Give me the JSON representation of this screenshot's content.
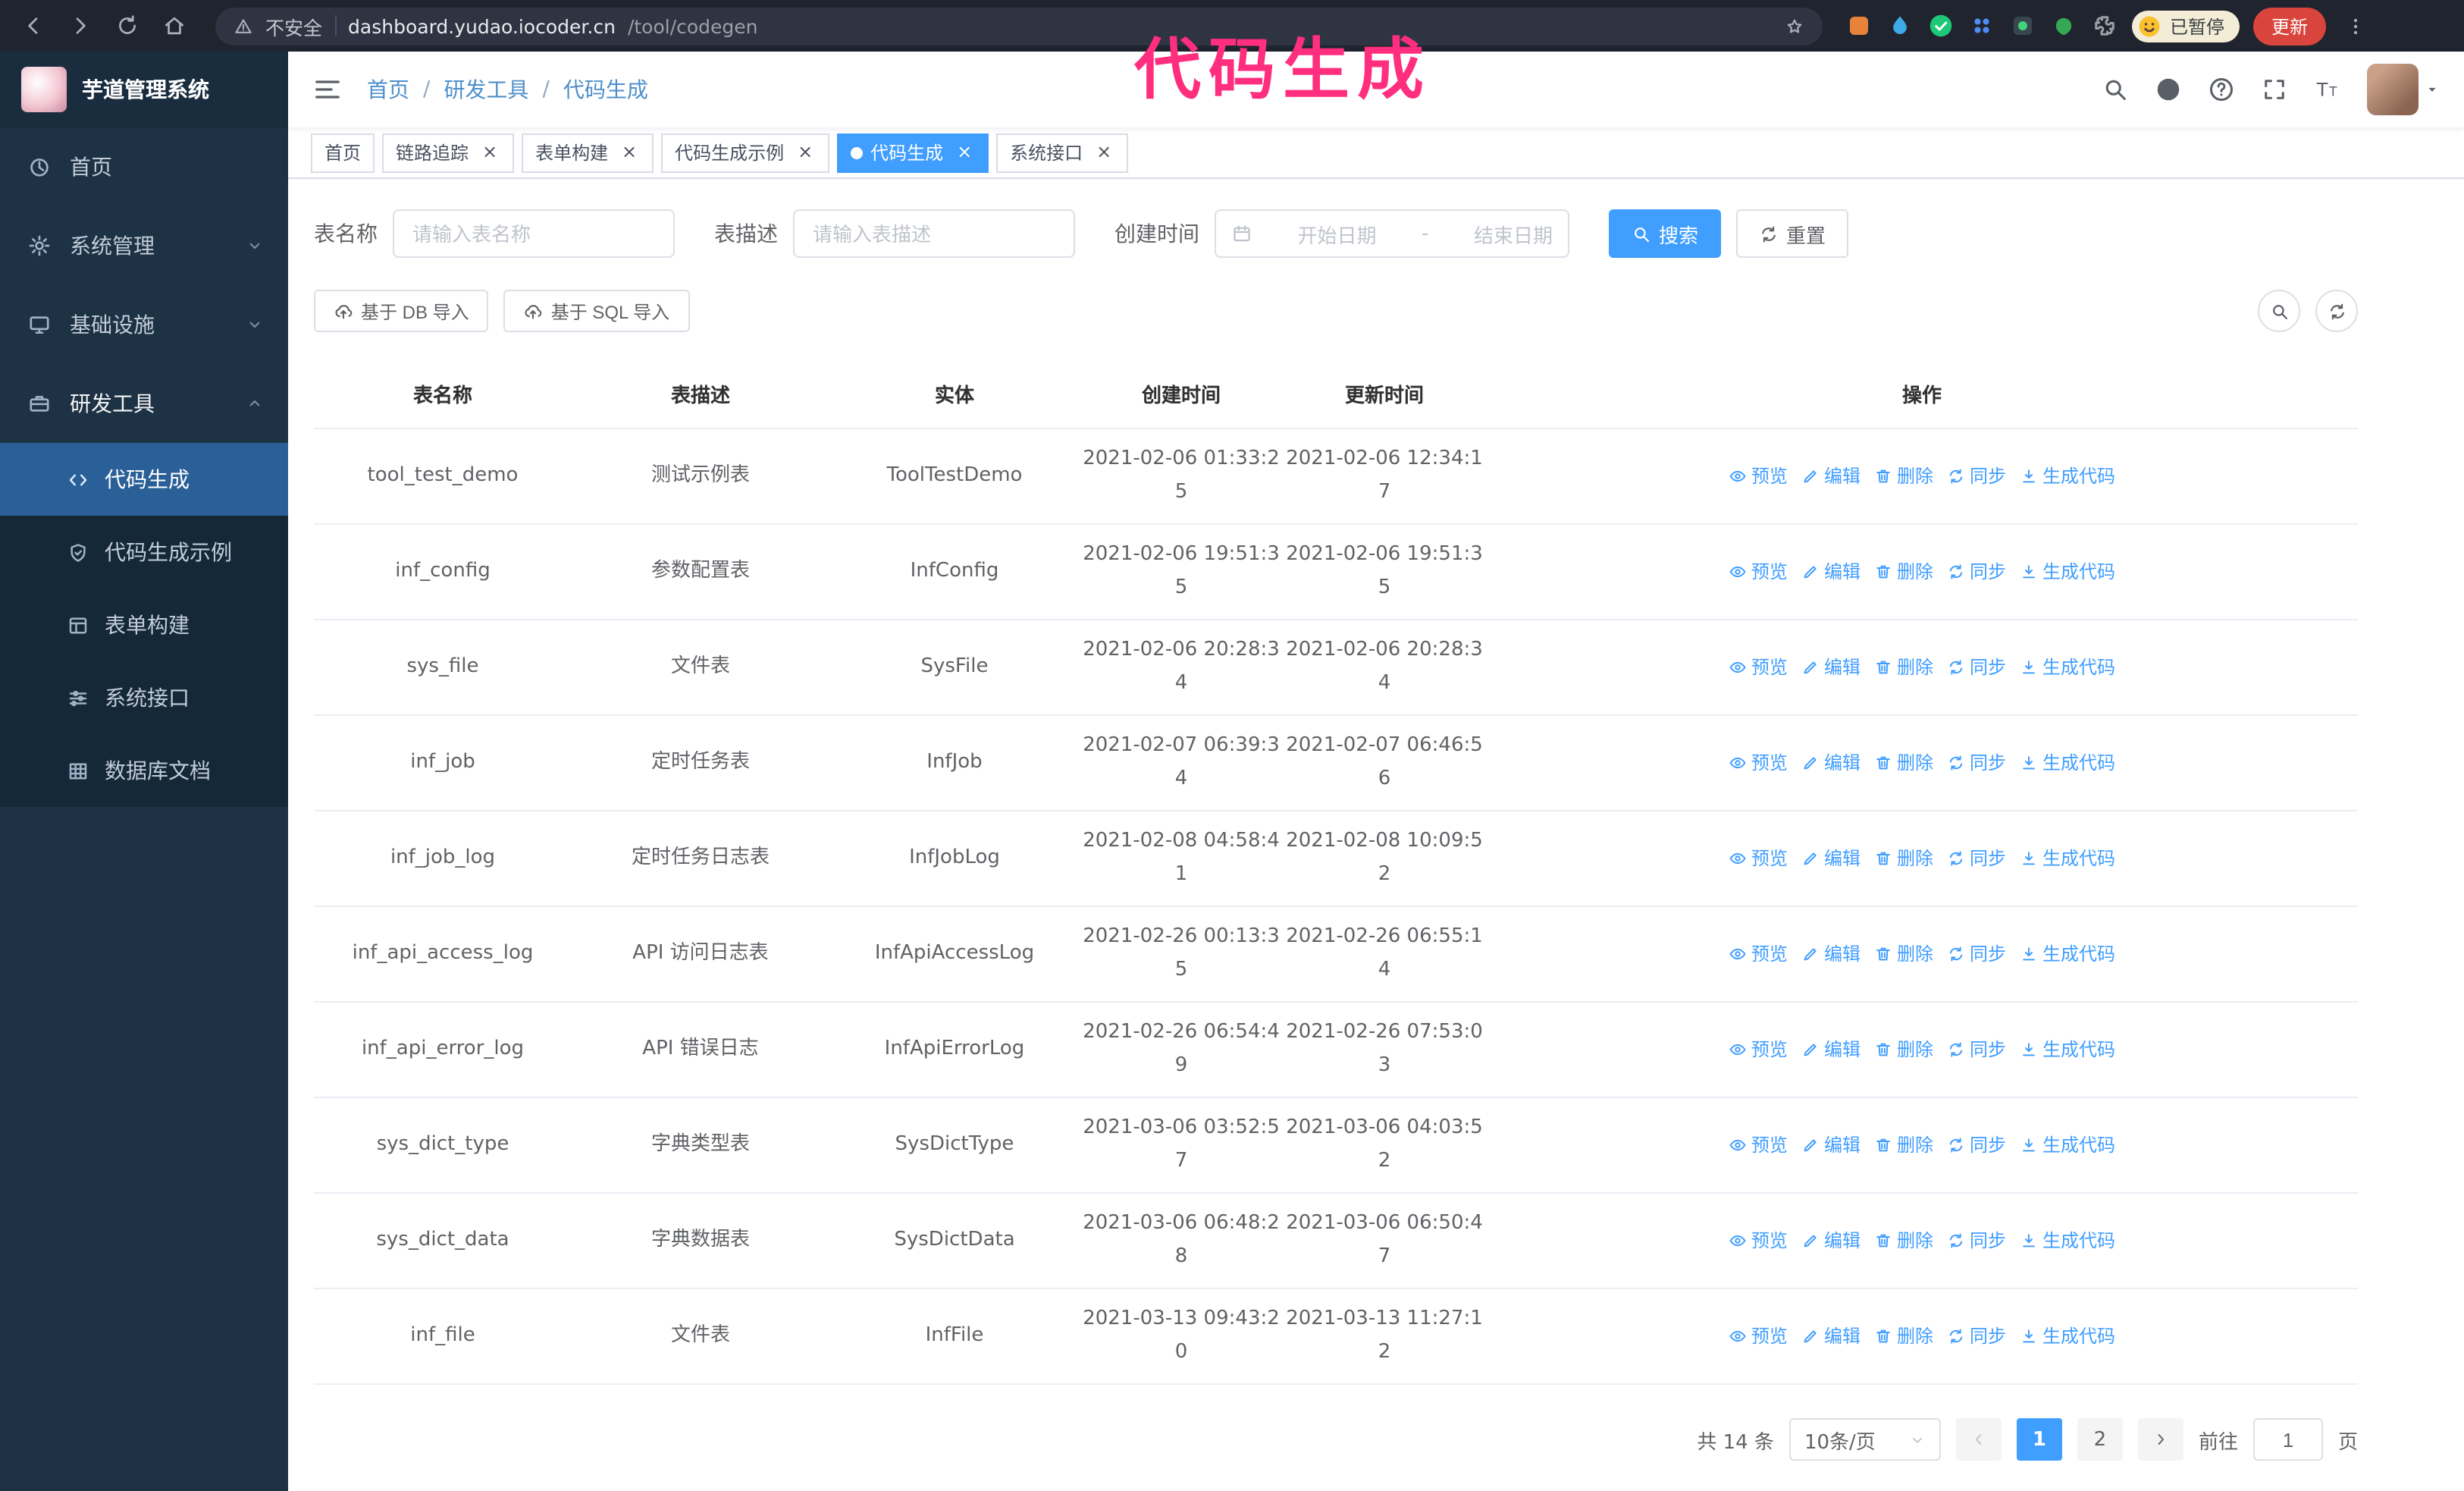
{
  "browser": {
    "security_label": "不安全",
    "url_host": "dashboard.yudao.iocoder.cn",
    "url_path": "/tool/codegen",
    "profile_badge": "已暂停",
    "update_button": "更新"
  },
  "annotation": {
    "text": "代码生成",
    "color": "#ff2e7e"
  },
  "sidebar": {
    "logo_title": "芋道管理系统",
    "menu": [
      {
        "label": "首页"
      },
      {
        "label": "系统管理"
      },
      {
        "label": "基础设施"
      },
      {
        "label": "研发工具"
      }
    ],
    "submenu": [
      {
        "label": "代码生成"
      },
      {
        "label": "代码生成示例"
      },
      {
        "label": "表单构建"
      },
      {
        "label": "系统接口"
      },
      {
        "label": "数据库文档"
      }
    ]
  },
  "header": {
    "breadcrumb": [
      "首页",
      "研发工具",
      "代码生成"
    ],
    "separator": "/"
  },
  "tabs": [
    {
      "label": "首页"
    },
    {
      "label": "链路追踪"
    },
    {
      "label": "表单构建"
    },
    {
      "label": "代码生成示例"
    },
    {
      "label": "代码生成"
    },
    {
      "label": "系统接口"
    }
  ],
  "filters": {
    "table_name_label": "表名称",
    "table_name_placeholder": "请输入表名称",
    "table_desc_label": "表描述",
    "table_desc_placeholder": "请输入表描述",
    "create_time_label": "创建时间",
    "date_start_placeholder": "开始日期",
    "date_separator": "-",
    "date_end_placeholder": "结束日期",
    "search_button": "搜索",
    "reset_button": "重置"
  },
  "toolbar": {
    "import_db": "基于 DB 导入",
    "import_sql": "基于 SQL 导入"
  },
  "table": {
    "columns": [
      "表名称",
      "表描述",
      "实体",
      "创建时间",
      "更新时间",
      "操作"
    ],
    "actions": [
      "预览",
      "编辑",
      "删除",
      "同步",
      "生成代码"
    ],
    "rows": [
      {
        "name": "tool_test_demo",
        "desc": "测试示例表",
        "entity": "ToolTestDemo",
        "created": "2021-02-06 01:33:25",
        "updated": "2021-02-06 12:34:17"
      },
      {
        "name": "inf_config",
        "desc": "参数配置表",
        "entity": "InfConfig",
        "created": "2021-02-06 19:51:35",
        "updated": "2021-02-06 19:51:35"
      },
      {
        "name": "sys_file",
        "desc": "文件表",
        "entity": "SysFile",
        "created": "2021-02-06 20:28:34",
        "updated": "2021-02-06 20:28:34"
      },
      {
        "name": "inf_job",
        "desc": "定时任务表",
        "entity": "InfJob",
        "created": "2021-02-07 06:39:34",
        "updated": "2021-02-07 06:46:56"
      },
      {
        "name": "inf_job_log",
        "desc": "定时任务日志表",
        "entity": "InfJobLog",
        "created": "2021-02-08 04:58:41",
        "updated": "2021-02-08 10:09:52"
      },
      {
        "name": "inf_api_access_log",
        "desc": "API 访问日志表",
        "entity": "InfApiAccessLog",
        "created": "2021-02-26 00:13:35",
        "updated": "2021-02-26 06:55:14"
      },
      {
        "name": "inf_api_error_log",
        "desc": "API 错误日志",
        "entity": "InfApiErrorLog",
        "created": "2021-02-26 06:54:49",
        "updated": "2021-02-26 07:53:03"
      },
      {
        "name": "sys_dict_type",
        "desc": "字典类型表",
        "entity": "SysDictType",
        "created": "2021-03-06 03:52:57",
        "updated": "2021-03-06 04:03:52"
      },
      {
        "name": "sys_dict_data",
        "desc": "字典数据表",
        "entity": "SysDictData",
        "created": "2021-03-06 06:48:28",
        "updated": "2021-03-06 06:50:47"
      },
      {
        "name": "inf_file",
        "desc": "文件表",
        "entity": "InfFile",
        "created": "2021-03-13 09:43:20",
        "updated": "2021-03-13 11:27:12"
      }
    ]
  },
  "pagination": {
    "total": "共 14 条",
    "page_size": "10条/页",
    "page_1": "1",
    "page_2": "2",
    "goto_label": "前往",
    "goto_value": "1",
    "goto_unit": "页"
  },
  "icons": {
    "close": "×"
  }
}
